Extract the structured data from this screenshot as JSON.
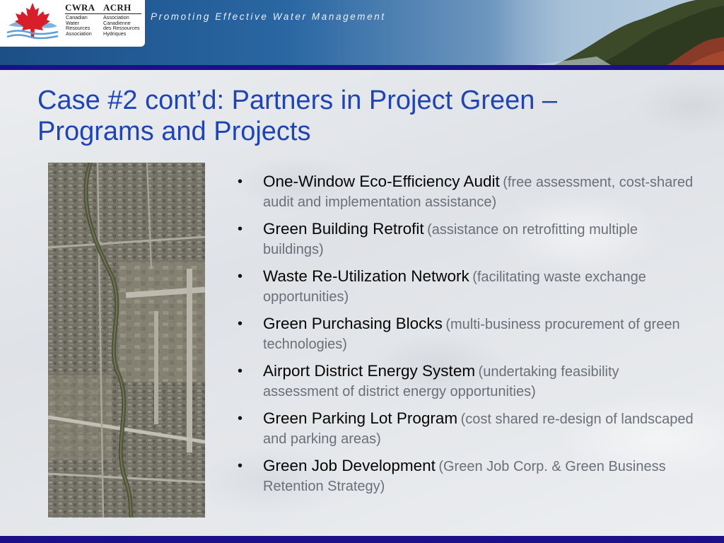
{
  "header": {
    "logo": {
      "cwra": "CWRA",
      "acrh": "ACRH",
      "english_name": "Canadian\nWater\nResources\nAssociation",
      "french_name": "Association\nCanadienne\ndes Ressources\nHydriques"
    },
    "tagline": "Promoting Effective Water Management"
  },
  "slide": {
    "title_line1": "Case #2 cont’d:  Partners in Project Green –",
    "title_line2": "Programs and Projects",
    "bullets": [
      {
        "main": "One-Window Eco-Efficiency Audit",
        "detail": "(free assessment, cost-shared audit and implementation assistance)"
      },
      {
        "main": "Green Building Retrofit",
        "detail": "(assistance on retrofitting multiple buildings)"
      },
      {
        "main": "Waste Re-Utilization Network",
        "detail": "(facilitating waste exchange opportunities)"
      },
      {
        "main": "Green Purchasing Blocks",
        "detail": "(multi-business procurement of green technologies)"
      },
      {
        "main": "Airport District Energy System",
        "detail": "(undertaking feasibility assessment of district energy opportunities)"
      },
      {
        "main": "Green Parking Lot Program",
        "detail": "(cost shared re-design of landscaped and parking areas)"
      },
      {
        "main": "Green Job Development",
        "detail": "(Green Job Corp. & Green Business Retention Strategy)"
      }
    ]
  },
  "icons": {
    "logo": "maple-leaf-icon",
    "bullet": "bullet-dot"
  },
  "colors": {
    "title": "#1f45b4",
    "bar": "#1c0f8a",
    "maple_leaf": "#d81e2a",
    "detail_text": "#6b6f78"
  }
}
